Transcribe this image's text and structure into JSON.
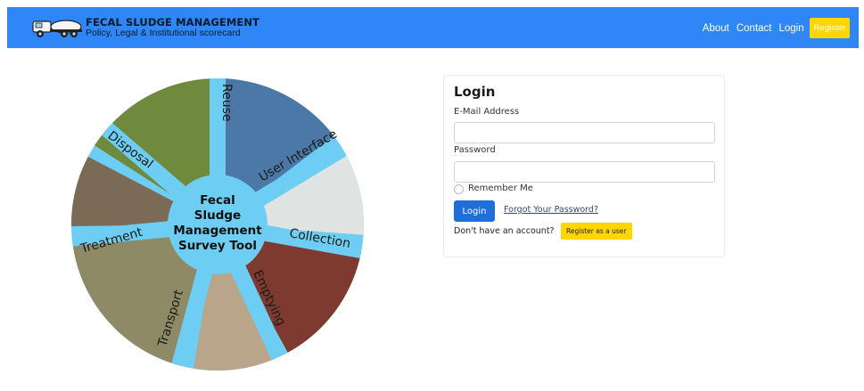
{
  "navbar": {
    "brand_title": "FECAL SLUDGE MANAGEMENT",
    "brand_subtitle": "Policy, Legal & Institutional scorecard",
    "links": [
      "About",
      "Contact",
      "Login"
    ],
    "register_label": "Register",
    "bg_color": "#2f86f6",
    "register_color": "#ffd600"
  },
  "wheel": {
    "center_lines": [
      "Fecal",
      "Sludge",
      "Management",
      "Survey Tool"
    ],
    "segments": [
      "Reuse",
      "User Interface",
      "Collection",
      "Emptying",
      "Transport",
      "Treatment",
      "Disposal"
    ],
    "spoke_color": "#6ecdf2"
  },
  "login": {
    "title": "Login",
    "email_label": "E-Mail Address",
    "email_value": "",
    "password_label": "Password",
    "password_value": "",
    "remember_label": "Remember Me",
    "login_button": "Login",
    "forgot_link": "Forgot Your Password?",
    "no_account_text": "Don't have an account?",
    "register_user_button": "Register as a user",
    "button_color": "#1f6fdb"
  }
}
